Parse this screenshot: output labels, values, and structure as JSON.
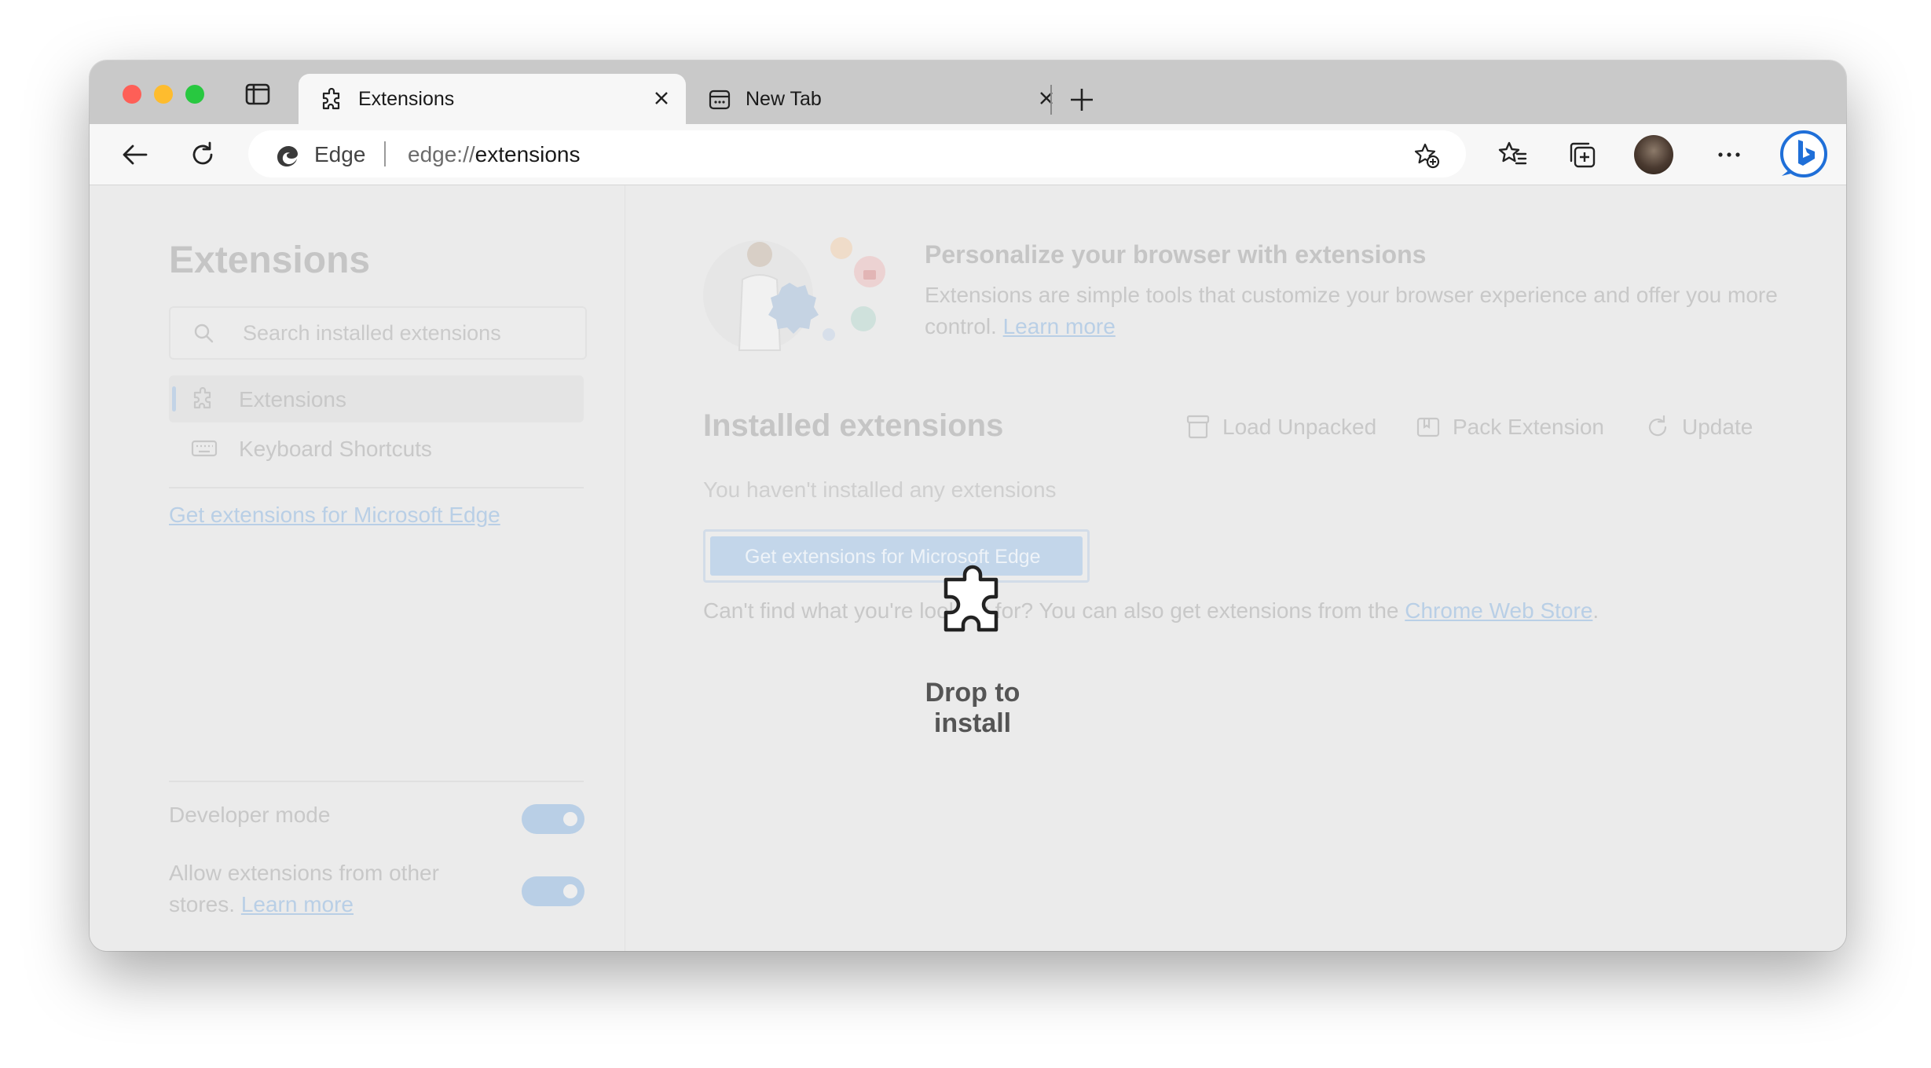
{
  "tabs": [
    {
      "label": "Extensions",
      "icon": "puzzle-icon",
      "active": true
    },
    {
      "label": "New Tab",
      "icon": "newtab-page-icon",
      "active": false
    }
  ],
  "omnibox": {
    "site_label": "Edge",
    "url_prefix": "edge://",
    "url_host": "extensions"
  },
  "sidebar": {
    "title": "Extensions",
    "search_placeholder": "Search installed extensions",
    "nav": [
      {
        "label": "Extensions",
        "icon": "puzzle-icon",
        "selected": true
      },
      {
        "label": "Keyboard Shortcuts",
        "icon": "keyboard-icon",
        "selected": false
      }
    ],
    "get_link": "Get extensions for Microsoft Edge",
    "developer_mode_label": "Developer mode",
    "allow_other_stores_label": "Allow extensions from other stores.",
    "allow_other_stores_link": "Learn more",
    "developer_mode_on": true,
    "allow_other_stores_on": true
  },
  "main": {
    "hero_title": "Personalize your browser with extensions",
    "hero_desc": "Extensions are simple tools that customize your browser experience and offer you more control.",
    "hero_link": "Learn more",
    "installed_title": "Installed extensions",
    "actions": {
      "load_unpacked": "Load Unpacked",
      "pack_extension": "Pack Extension",
      "update": "Update"
    },
    "empty_message": "You haven't installed any extensions",
    "store_button": "Get extensions for Microsoft Edge",
    "cws_prefix": "Can't find what you're looking for? You can also get extensions from the",
    "cws_link": "Chrome Web Store",
    "cws_suffix": "."
  },
  "drop_overlay": {
    "label": "Drop to install",
    "icon": "puzzle-icon"
  },
  "colors": {
    "accent_faded": "#b9cfe6",
    "traffic_red": "#fe5f57",
    "traffic_yellow": "#febc2e",
    "traffic_green": "#28c840",
    "bing_blue": "#1f6fd8"
  }
}
